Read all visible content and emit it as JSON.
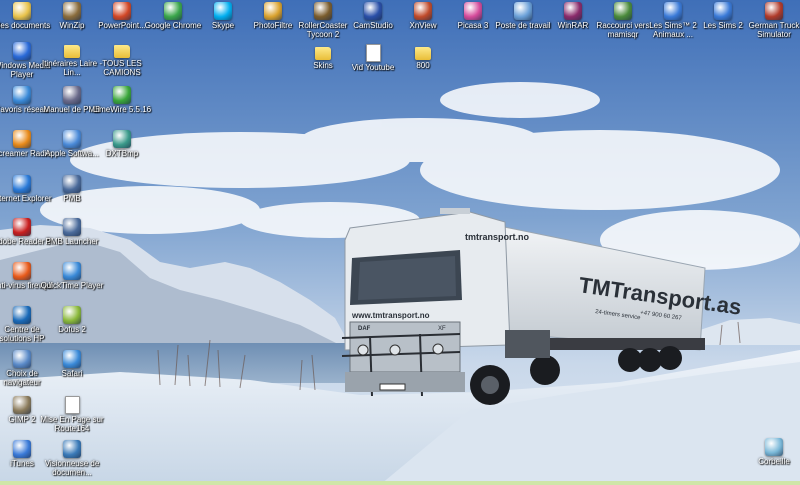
{
  "desktop": {
    "icons": [
      {
        "label": "Mes documents",
        "icon": "my-documents-icon",
        "color": "#e8c24a"
      },
      {
        "label": "WinZip",
        "icon": "winzip-icon",
        "color": "#8a6c3c"
      },
      {
        "label": "PowerPoint...",
        "icon": "powerpoint-icon",
        "color": "#d24726"
      },
      {
        "label": "Google Chrome",
        "icon": "chrome-icon",
        "color": "#3aa64a"
      },
      {
        "label": "Skype",
        "icon": "skype-icon",
        "color": "#00aff0"
      },
      {
        "label": "PhotoFiltre",
        "icon": "photofiltre-icon",
        "color": "#d9a12c"
      },
      {
        "label": "RollerCoaster Tycoon 2",
        "icon": "rollercoaster-icon",
        "color": "#7a5c2c"
      },
      {
        "label": "CamStudio",
        "icon": "camstudio-icon",
        "color": "#2a4fa8"
      },
      {
        "label": "XnView",
        "icon": "xnview-icon",
        "color": "#c04a2a"
      },
      {
        "label": "Picasa 3",
        "icon": "picasa-icon",
        "color": "#d54a9a"
      },
      {
        "label": "Poste de travail",
        "icon": "my-computer-icon",
        "color": "#6aa0d8"
      },
      {
        "label": "WinRAR",
        "icon": "winrar-icon",
        "color": "#8a2a6a"
      },
      {
        "label": "Raccourci vers mamisqr",
        "icon": "shortcut-icon",
        "color": "#4a8a3a"
      },
      {
        "label": "Les Sims™ 2 Animaux ...",
        "icon": "sims-icon",
        "color": "#3a7ad8"
      },
      {
        "label": "Les Sims 2",
        "icon": "sims-icon",
        "color": "#3a7ad8"
      },
      {
        "label": "German Truck Simulator",
        "icon": "truck-sim-icon",
        "color": "#b03a2a"
      },
      {
        "label": "Skins",
        "icon": "folder-icon",
        "color": "#e8c24a"
      },
      {
        "label": "Vid Youtube",
        "icon": "document-icon",
        "color": "#ffffff"
      },
      {
        "label": "800",
        "icon": "folder-icon",
        "color": "#e8c24a"
      },
      {
        "label": "Windows Media Player",
        "icon": "media-player-icon",
        "color": "#2a6ad8"
      },
      {
        "label": "Itinéraires Laire - Lin...",
        "icon": "folder-icon",
        "color": "#e8c24a"
      },
      {
        "label": "TOUS LES CAMIONS",
        "icon": "folder-icon",
        "color": "#e8c24a"
      },
      {
        "label": "Favoris réseau",
        "icon": "network-icon",
        "color": "#3a8ad8"
      },
      {
        "label": "Manuel de PMB",
        "icon": "manual-icon",
        "color": "#6a6a8a"
      },
      {
        "label": "LimeWire 5.5.16",
        "icon": "limewire-icon",
        "color": "#3aa63a"
      },
      {
        "label": "Screamer Radio",
        "icon": "radio-icon",
        "color": "#e88a1a"
      },
      {
        "label": "Apple Softwa...",
        "icon": "apple-update-icon",
        "color": "#4a8ad8"
      },
      {
        "label": "DXTBmp",
        "icon": "dxtbmp-icon",
        "color": "#3a9a8a"
      },
      {
        "label": "Internet Explorer",
        "icon": "ie-icon",
        "color": "#2a7ad8"
      },
      {
        "label": "PMB",
        "icon": "pmb-icon",
        "color": "#4a6a9a"
      },
      {
        "label": "Adobe Reader 9",
        "icon": "adobe-reader-icon",
        "color": "#c81e1e"
      },
      {
        "label": "PMB Launcher",
        "icon": "pmb-launcher-icon",
        "color": "#4a6a9a"
      },
      {
        "label": "Anti-virus firewall",
        "icon": "antivirus-icon",
        "color": "#e85a1a"
      },
      {
        "label": "QuickTime Player",
        "icon": "quicktime-icon",
        "color": "#3a8ad8"
      },
      {
        "label": "Centre de solutions HP",
        "icon": "hp-icon",
        "color": "#1a6ab8"
      },
      {
        "label": "Dofus 2",
        "icon": "dofus-icon",
        "color": "#8ab83a"
      },
      {
        "label": "Choix de navigateur",
        "icon": "browser-choice-icon",
        "color": "#5a8ac8"
      },
      {
        "label": "Safari",
        "icon": "safari-icon",
        "color": "#3a8ad8"
      },
      {
        "label": "GIMP 2",
        "icon": "gimp-icon",
        "color": "#8a7a5a"
      },
      {
        "label": "Mise En Page sur Route164",
        "icon": "document-icon",
        "color": "#ffffff"
      },
      {
        "label": "iTunes",
        "icon": "itunes-icon",
        "color": "#3a7ad8"
      },
      {
        "label": "Visionneuse de documen...",
        "icon": "document-viewer-icon",
        "color": "#3a7ab8"
      },
      {
        "label": "Corbeille",
        "icon": "recycle-bin-icon",
        "color": "#7ab8d8"
      }
    ],
    "truck": {
      "website": "www.tmtransport.no",
      "trailer_brand": "TMTransport.as",
      "cab_brand": "tmtransport.no",
      "grille": "DAF",
      "model": "XF",
      "phone": "+47 900 60 267",
      "slogan": "24-timers service"
    }
  }
}
